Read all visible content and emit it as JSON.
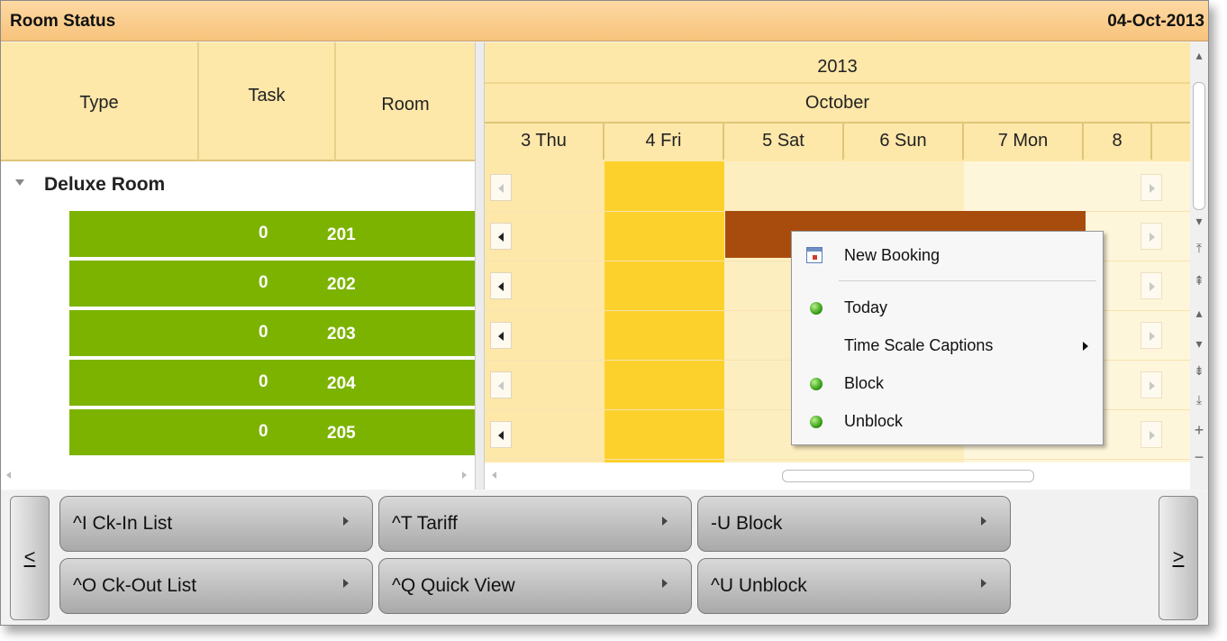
{
  "header": {
    "title": "Room Status",
    "date": "04-Oct-2013"
  },
  "columns": {
    "type": "Type",
    "task": "Task",
    "room": "Room"
  },
  "group": {
    "label": "Deluxe Room"
  },
  "rooms": [
    {
      "task": "0",
      "room": "201"
    },
    {
      "task": "0",
      "room": "202"
    },
    {
      "task": "0",
      "room": "203"
    },
    {
      "task": "0",
      "room": "204"
    },
    {
      "task": "0",
      "room": "205"
    }
  ],
  "scheduler": {
    "year": "2013",
    "month": "October",
    "days": [
      "3 Thu",
      "4 Fri",
      "5 Sat",
      "6 Sun",
      "7 Mon",
      "8 "
    ]
  },
  "context_menu": {
    "new_booking": "New Booking",
    "today": "Today",
    "time_scale_captions": "Time Scale Captions",
    "block": "Block",
    "unblock": "Unblock"
  },
  "toolbar": {
    "prev": "<",
    "next": ">",
    "ck_in_list": "^I Ck-In List",
    "ck_out_list": "^O Ck-Out List",
    "tariff": "^T Tariff",
    "quick_view": "^Q Quick View",
    "block": "-U Block",
    "unblock": "^U Unblock"
  },
  "colors": {
    "header_bg": "#f7c37b",
    "room_green": "#7cb300",
    "today_column": "#fdd12b",
    "booking": "#a84c0d",
    "grid_cream": "#fde7a9"
  }
}
